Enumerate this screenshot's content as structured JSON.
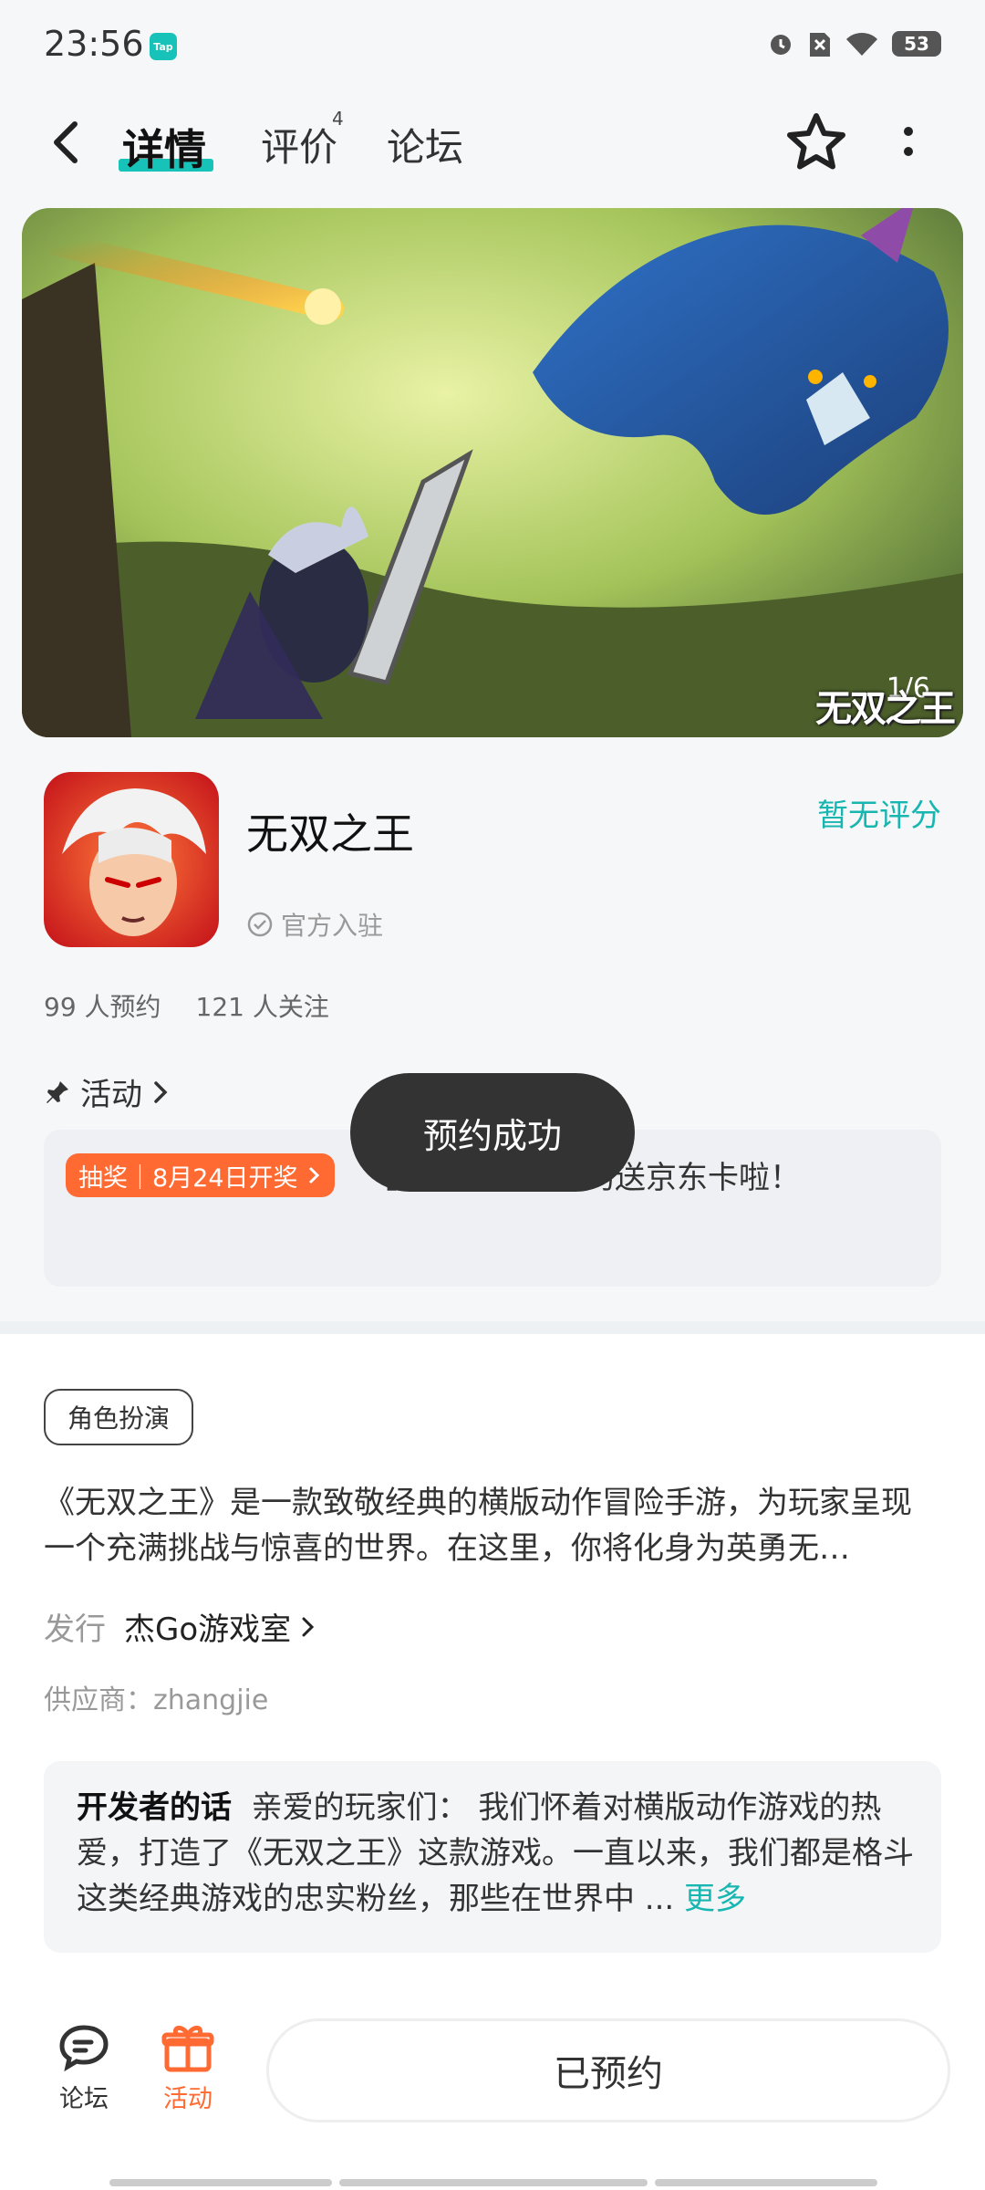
{
  "status_bar": {
    "time": "23:56",
    "app_badge": "Tap",
    "battery": "53"
  },
  "nav": {
    "tabs": [
      {
        "label": "详情",
        "active": true
      },
      {
        "label": "评价",
        "badge": "4"
      },
      {
        "label": "论坛"
      }
    ]
  },
  "banner": {
    "counter": "1/6",
    "logo_text": "无双之王"
  },
  "app": {
    "name": "无双之王",
    "verified_label": "官方入驻",
    "rating": "暂无评分",
    "reservations": "99 人预约",
    "followers": "121 人关注"
  },
  "activity": {
    "header": "活动",
    "tag": "抽奖｜8月24日开奖",
    "text": "【预约福利】预约送京东卡啦！"
  },
  "toast": "预约成功",
  "detail": {
    "genre": "角色扮演",
    "description": "《无双之王》是一款致敬经典的横版动作冒险手游，为玩家呈现一个充满挑战与惊喜的世界。在这里，你将化身为英勇无…",
    "publisher_label": "发行",
    "publisher": "杰Go游戏室",
    "supplier": "供应商：zhangjie"
  },
  "developer": {
    "title": "开发者的话",
    "text": "亲爱的玩家们： 我们怀着对横版动作游戏的热爱，打造了《无双之王》这款游戏。一直以来，我们都是格斗这类经典游戏的忠实粉丝，那些在世界中 ...",
    "more": "更多"
  },
  "bottom_bar": {
    "forum_label": "论坛",
    "activity_label": "活动",
    "reserved_button": "已预约"
  },
  "colors": {
    "accent": "#17c3b8",
    "orange": "#ff6a33",
    "toast_bg": "#333333"
  }
}
